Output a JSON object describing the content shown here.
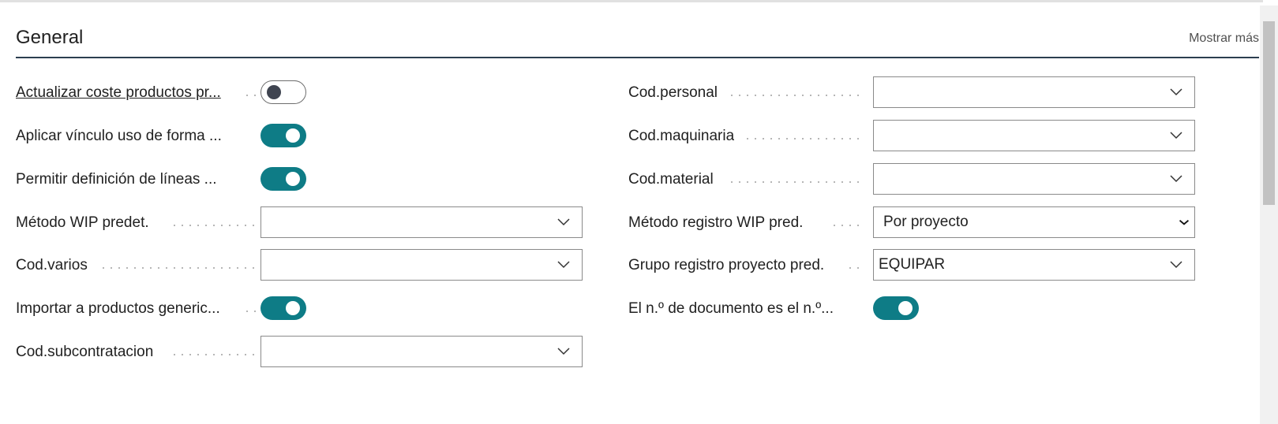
{
  "section": {
    "title": "General",
    "show_more": "Mostrar más"
  },
  "left_fields": [
    {
      "label": "Actualizar coste productos pr...",
      "type": "toggle",
      "state": "off"
    },
    {
      "label": "Aplicar vínculo uso de forma ...",
      "type": "toggle",
      "state": "on"
    },
    {
      "label": "Permitir definición de líneas ...",
      "type": "toggle",
      "state": "on"
    },
    {
      "label": "Método WIP predet.",
      "type": "select",
      "value": ""
    },
    {
      "label": "Cod.varios",
      "type": "select",
      "value": ""
    },
    {
      "label": "Importar a productos generic...",
      "type": "toggle",
      "state": "on"
    },
    {
      "label": "Cod.subcontratacion",
      "type": "select",
      "value": ""
    }
  ],
  "right_fields": [
    {
      "label": "Cod.personal",
      "type": "select",
      "value": ""
    },
    {
      "label": "Cod.maquinaria",
      "type": "select",
      "value": ""
    },
    {
      "label": "Cod.material",
      "type": "select",
      "value": ""
    },
    {
      "label": "Método registro WIP pred.",
      "type": "select",
      "value": "Por proyecto"
    },
    {
      "label": "Grupo registro proyecto pred.",
      "type": "select",
      "value": "EQUIPAR"
    },
    {
      "label": "El n.º de documento es el n.º...",
      "type": "toggle",
      "state": "on"
    }
  ],
  "colors": {
    "toggle_on": "#0e7c86",
    "header_rule": "#2c3e50"
  },
  "icons": {
    "dropdown": "chevron-down-icon"
  }
}
